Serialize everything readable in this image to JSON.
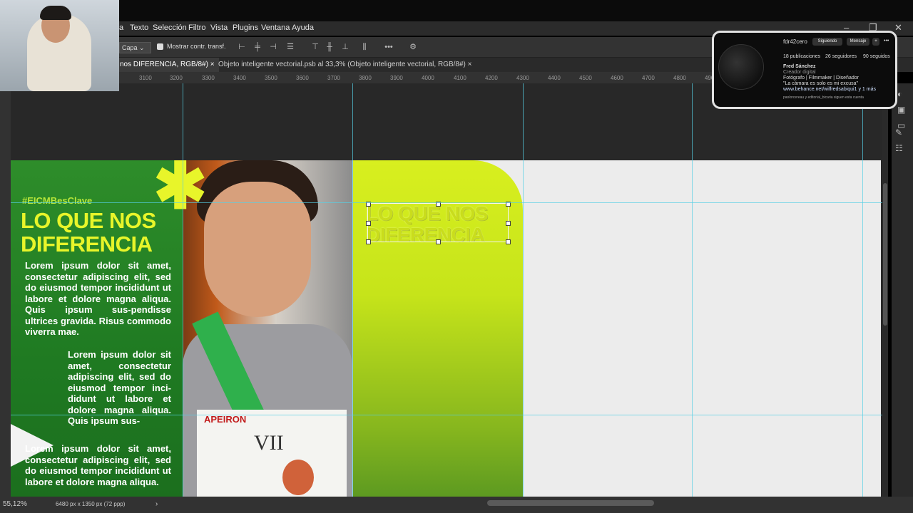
{
  "menu": {
    "items": [
      "a",
      "Texto",
      "Selección",
      "Filtro",
      "Vista",
      "Plugins",
      "Ventana",
      "Ayuda"
    ]
  },
  "options_bar": {
    "layer_select": "Capa",
    "show_transform": "Mostrar contr. transf."
  },
  "tabs": [
    {
      "label": "nos DIFERENCIA, RGB/8#)",
      "active": true
    },
    {
      "label": "Objeto inteligente vectorial.psb al 33,3% (Objeto inteligente vectorial, RGB/8#)",
      "active": false
    }
  ],
  "ruler": [
    "3100",
    "3200",
    "3300",
    "3400",
    "3500",
    "3600",
    "3700",
    "3800",
    "3900",
    "4000",
    "4100",
    "4200",
    "4300",
    "4400",
    "4500",
    "4600",
    "4700",
    "4800",
    "4900"
  ],
  "artboard": {
    "hashtag": "#EICMBesClave",
    "headline_line1": "LO QUE NOS",
    "headline_line2": "DIFERENCIA",
    "paragraph1": "Lorem ipsum dolor sit amet, consectetur adipiscing elit, sed do eiusmod tempor incididunt ut labore et dolore magna aliqua. Quis ipsum sus-pendisse ultrices gravida. Risus commodo viverra mae.",
    "paragraph2": "Lorem ipsum dolor sit amet, consectetur adipiscing elit, sed do eiusmod tempor inci-didunt ut labore et dolore magna aliqua. Quis ipsum sus-",
    "paragraph3": "Lorem ipsum dolor sit amet, consectetur adipiscing elit, sed do eiusmod tempor incididunt ut labore et dolore magna aliqua.",
    "cert_brand": "APEIRON",
    "cert_title": "VII",
    "selected_text_line1": "LO QUE NOS",
    "selected_text_line2": "DIFERENCIA"
  },
  "status": {
    "zoom": "55,12%",
    "doc_size": "6480 px x 1350 px (72 ppp)"
  },
  "instagram": {
    "username": "fdr42cero",
    "following_btn": "Siguiendo",
    "message_btn": "Mensaje",
    "posts": "18 publicaciones",
    "followers": "26 seguidores",
    "following": "90 seguidos",
    "name": "Fred Sánchez",
    "category": "Creador digital",
    "bio1": "Fotógrafo | Filmmaker | Diseñador",
    "bio2": "\"La cámara es solo es mi excusa\"",
    "link": "www.behance.net/wilfredsabiqui1 y 1 más",
    "followed_by": "paolorcereau y editorial_bicaria siguen esta cuenta"
  },
  "colors": {
    "green_panel": "#1f7a22",
    "lime_panel": "#d8ef1f",
    "headline": "#e8f52a",
    "guide": "#55d0e6"
  }
}
